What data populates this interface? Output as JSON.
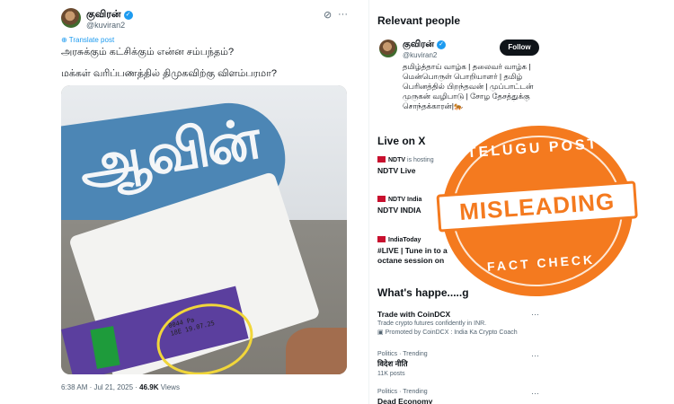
{
  "tweet": {
    "author_name": "குவிரன்",
    "author_handle": "@kuviran2",
    "translate_label": "Translate post",
    "text_line1": "அரசுக்கும் கட்சிக்கும் என்ன சம்பந்தம்?",
    "text_line2": "மக்கள் வரிப்பணத்தில் திமுகவிற்கு விளம்பரமா?",
    "time": "6:38 AM · Jul 21, 2025 ·",
    "views_count": "46.9K",
    "views_label": "Views",
    "photo_banner_text": "ஆவின்",
    "photo_print": "0044 Pa\n18E 19.07.25",
    "icons": {
      "grok": "grok-icon",
      "more": "more-icon"
    }
  },
  "sidebar": {
    "relevant_title": "Relevant people",
    "person": {
      "name": "குவிரன்",
      "handle": "@kuviran2",
      "follow_label": "Follow",
      "bio": "தமிழ்த்தாய் வாழ்க | தலைவர் வாழ்க | மென்பொருள் பொறியாளர் | தமிழ் பெரினத்தில் பிறந்தவன் | முப்பாட்டன் முருகன் வழிபாடு | சோழ தேசத்துக்கு சொந்தக்காரன்|🐅"
    },
    "live_title": "Live on X",
    "live": [
      {
        "source": "NDTV",
        "status": "is hosting",
        "title": "NDTV Live"
      },
      {
        "source": "NDTV India",
        "status": "",
        "title": "NDTV INDIA"
      },
      {
        "source": "IndiaToday",
        "status": "",
        "title": "#LIVE | Tune in to a",
        "title2": "octane session on"
      }
    ],
    "happening_title": "What's happe.....g",
    "trends": [
      {
        "category": "",
        "name": "Trade with CoinDCX",
        "desc": "Trade crypto futures confidently in INR.",
        "desc2": "Promoted by CoinDCX : India Ka Crypto Coach"
      },
      {
        "category": "Politics · Trending",
        "name": "विदेश नीति",
        "desc": "11K posts",
        "desc2": ""
      },
      {
        "category": "Politics · Trending",
        "name": "Dead Economy",
        "desc": "",
        "desc2": ""
      }
    ]
  },
  "stamp": {
    "top_text": "TELUGU POST",
    "main_text": "MISLEADING",
    "bottom_text": "FACT CHECK",
    "color": "#f47a1f"
  }
}
